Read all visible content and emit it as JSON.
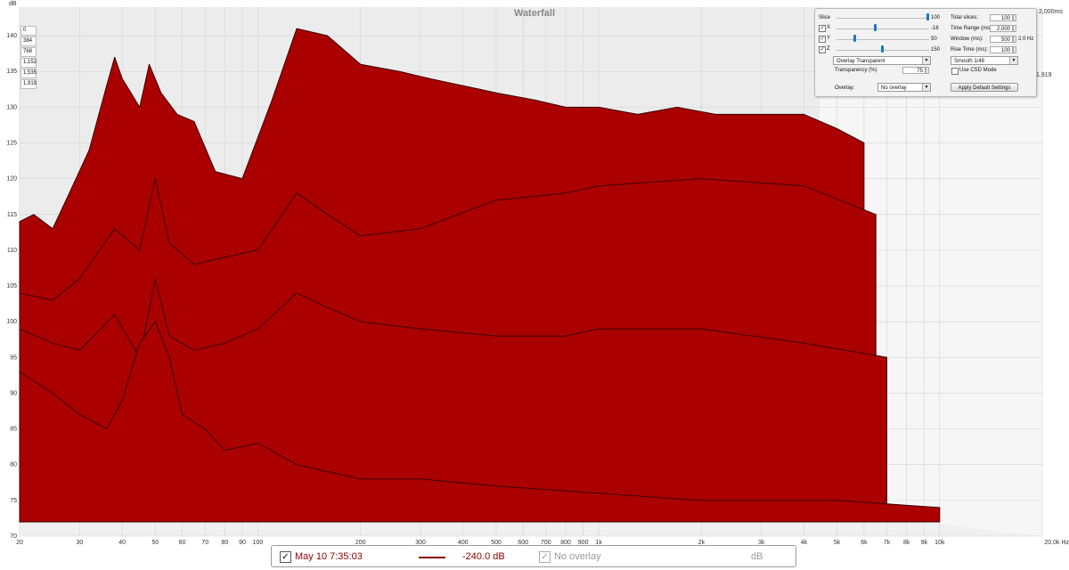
{
  "chart_data": {
    "type": "area",
    "title": "Waterfall",
    "ylabel": "dB",
    "ylim": [
      70,
      144
    ],
    "y_ticks": [
      70,
      75,
      80,
      85,
      90,
      95,
      100,
      105,
      110,
      115,
      120,
      125,
      130,
      135,
      140
    ],
    "xlim": [
      20,
      20000
    ],
    "x_scale": "log",
    "x_ticks": [
      {
        "v": 20,
        "label": "20"
      },
      {
        "v": 30,
        "label": "30"
      },
      {
        "v": 40,
        "label": "40"
      },
      {
        "v": 50,
        "label": "50"
      },
      {
        "v": 60,
        "label": "60"
      },
      {
        "v": 70,
        "label": "70"
      },
      {
        "v": 80,
        "label": "80"
      },
      {
        "v": 90,
        "label": "90"
      },
      {
        "v": 100,
        "label": "100"
      },
      {
        "v": 200,
        "label": "200"
      },
      {
        "v": 300,
        "label": "300"
      },
      {
        "v": 400,
        "label": "400"
      },
      {
        "v": 500,
        "label": "500"
      },
      {
        "v": 600,
        "label": "600"
      },
      {
        "v": 700,
        "label": "700"
      },
      {
        "v": 800,
        "label": "800"
      },
      {
        "v": 900,
        "label": "900"
      },
      {
        "v": 1000,
        "label": "1k"
      },
      {
        "v": 2000,
        "label": "2k"
      },
      {
        "v": 3000,
        "label": "3k"
      },
      {
        "v": 4000,
        "label": "4k"
      },
      {
        "v": 5000,
        "label": "5k"
      },
      {
        "v": 6000,
        "label": "6k"
      },
      {
        "v": 7000,
        "label": "7k"
      },
      {
        "v": 8000,
        "label": "8k"
      },
      {
        "v": 9000,
        "label": "9k"
      },
      {
        "v": 10000,
        "label": "10k"
      },
      {
        "v": 20000,
        "label": "20.0k Hz"
      }
    ],
    "time_axis_labels": [
      "0",
      "384",
      "768",
      "1,152",
      "1,535",
      "1,919"
    ],
    "time_axis_end_label": "1,919",
    "time_axis_top_label": "2,000ms",
    "fill_color": "#aa0000",
    "edge_color": "#3a0000",
    "series": [
      {
        "x": [
          20,
          22,
          25,
          28,
          32,
          36,
          38,
          40,
          45,
          48,
          52,
          58,
          65,
          75,
          90,
          110,
          130,
          160,
          200,
          260,
          320,
          400,
          500,
          650,
          800,
          1000,
          1300,
          1700,
          2200,
          3000,
          4000,
          5000,
          6000
        ],
        "y": [
          114,
          115,
          113,
          118,
          124,
          133,
          137,
          134,
          130,
          136,
          132,
          129,
          128,
          121,
          120,
          131,
          141,
          140,
          136,
          135,
          134,
          133,
          132,
          131,
          130,
          130,
          129,
          130,
          129,
          129,
          129,
          127,
          125
        ]
      },
      {
        "x": [
          20,
          25,
          30,
          38,
          45,
          50,
          55,
          65,
          80,
          100,
          130,
          160,
          200,
          300,
          500,
          800,
          1000,
          2000,
          4000,
          6500
        ],
        "y": [
          104,
          103,
          106,
          113,
          110,
          120,
          111,
          108,
          109,
          110,
          118,
          115,
          112,
          113,
          117,
          118,
          119,
          120,
          119,
          115
        ]
      },
      {
        "x": [
          20,
          25,
          30,
          38,
          45,
          50,
          55,
          65,
          80,
          100,
          130,
          160,
          200,
          300,
          500,
          800,
          1000,
          2000,
          4000,
          7000
        ],
        "y": [
          99,
          97,
          96,
          101,
          95,
          106,
          98,
          96,
          97,
          99,
          104,
          102,
          100,
          99,
          98,
          98,
          99,
          99,
          97,
          95
        ]
      },
      {
        "x": [
          20,
          25,
          30,
          36,
          40,
          45,
          50,
          55,
          60,
          70,
          80,
          100,
          130,
          200,
          300,
          500,
          1000,
          2000,
          5000,
          10000
        ],
        "y": [
          93,
          90,
          87,
          85,
          89,
          97,
          100,
          95,
          87,
          85,
          82,
          83,
          80,
          78,
          78,
          77,
          76,
          75,
          75,
          74
        ]
      }
    ]
  },
  "controls": {
    "slice_label": "Slice",
    "slice_value": "100",
    "x_label": "X",
    "x_value": "-16",
    "y_label": "Y",
    "y_value": "50",
    "z_label": "Z",
    "z_value": "150",
    "total_slices_label": "Total slices:",
    "total_slices_value": "100",
    "time_range_label": "Time Range (ms):",
    "time_range_value": "2,000",
    "window_label": "Window (ms):",
    "window_value": "500",
    "window_hz": "2.0 Hz",
    "rise_time_label": "Rise Time (ms):",
    "rise_time_value": "100",
    "overlay_mode": "Overlay Transparent",
    "smoothing": "Smooth 1/48",
    "transparency_label": "Transparency (%)",
    "transparency_value": "75",
    "use_csd_label": "Use CSD Mode",
    "overlay_label": "Overlay:",
    "overlay_value": "No overlay",
    "apply_button": "Apply Default Settings"
  },
  "statusbar": {
    "measurement": "May 10 7:35:03",
    "level": "-240.0 dB",
    "overlay": "No overlay",
    "unit": "dB",
    "trace_color": "#8b0000"
  }
}
